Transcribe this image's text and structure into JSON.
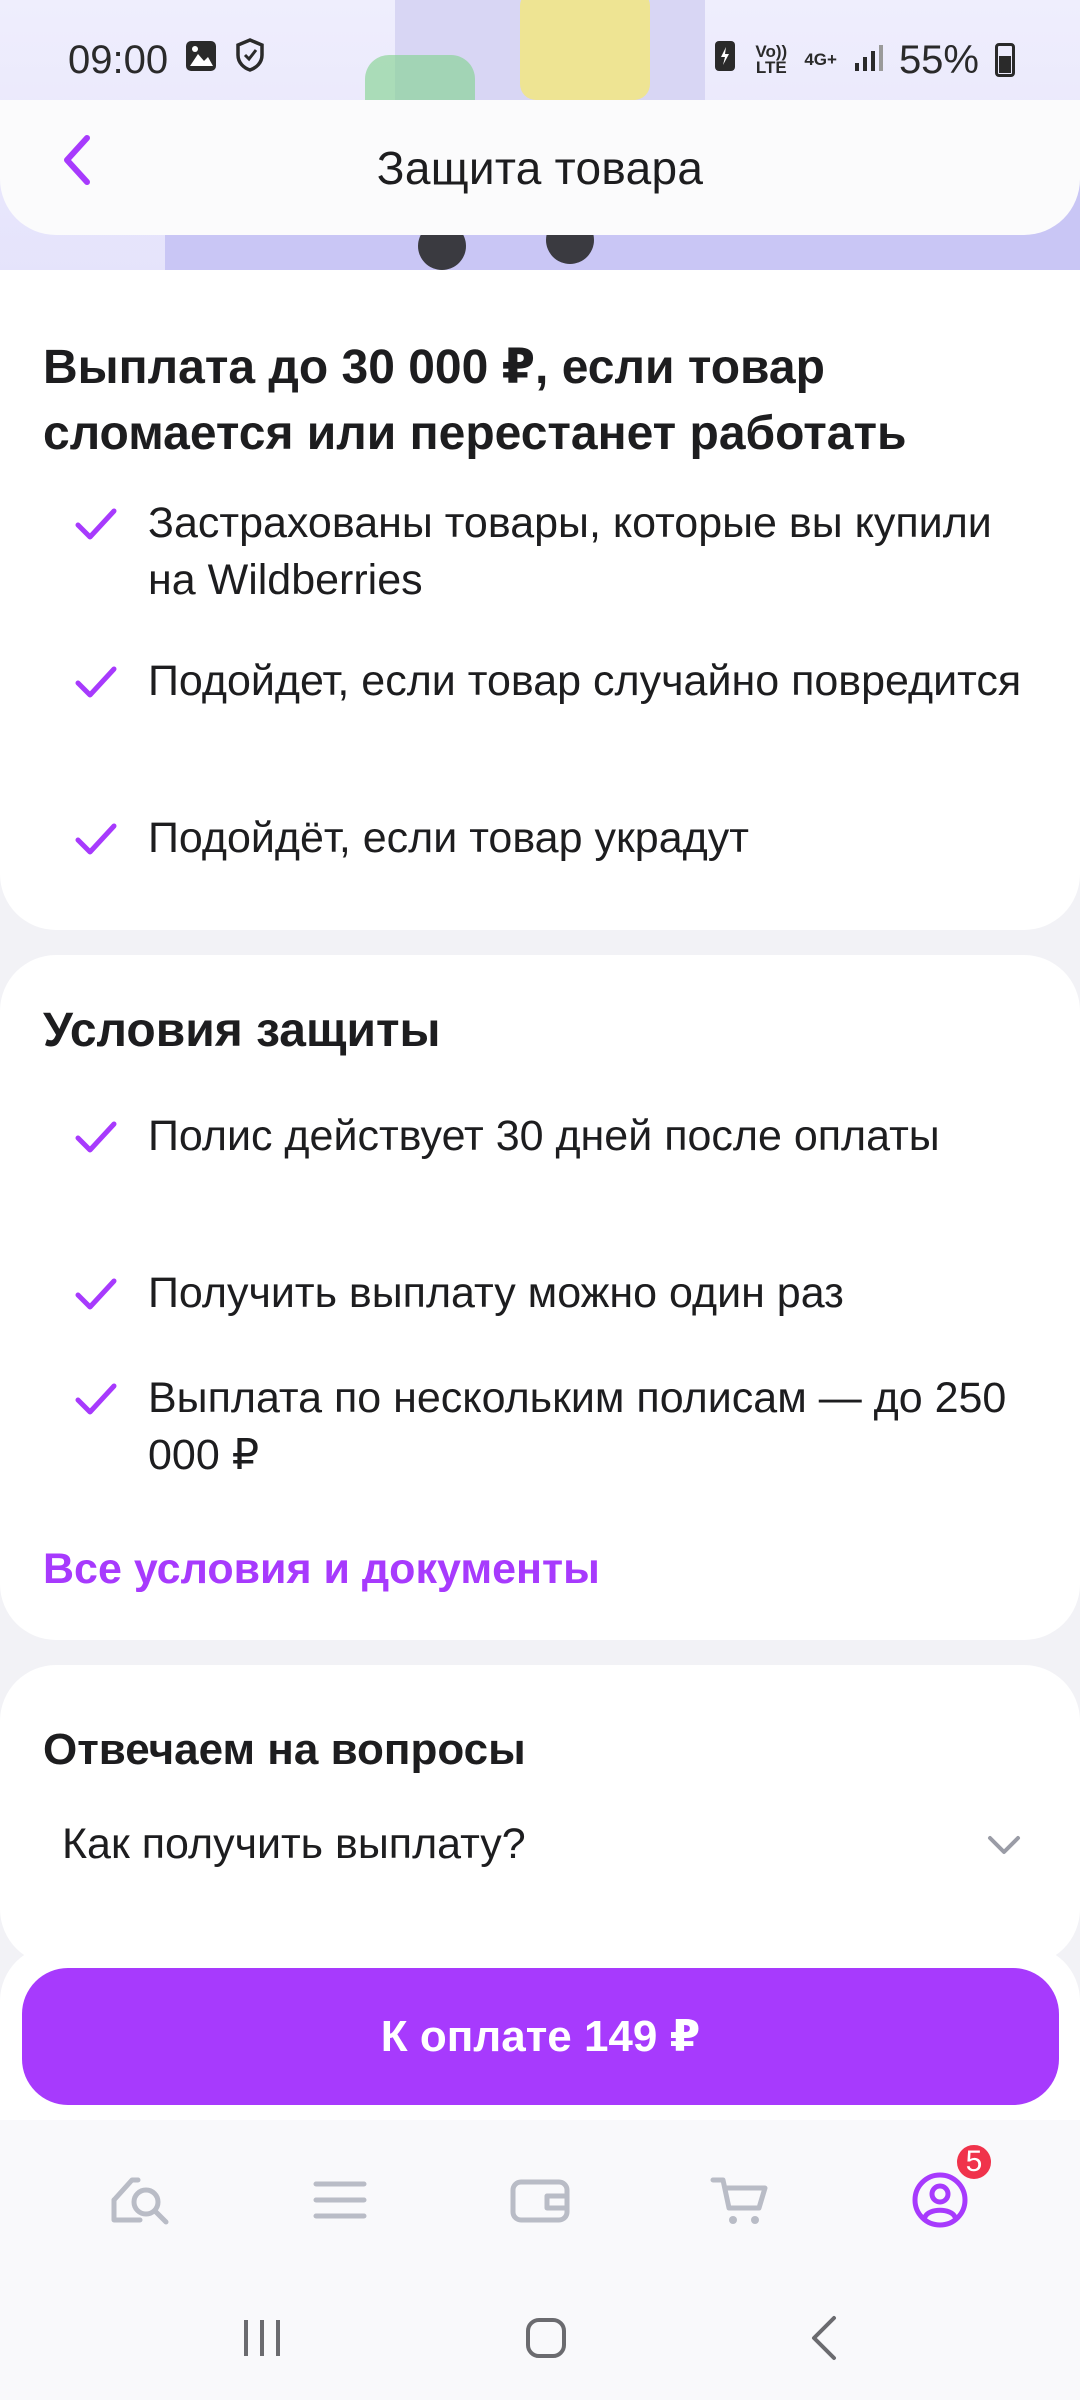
{
  "status_bar": {
    "time": "09:00",
    "net_volte": "Vo)) LTE",
    "net_4g": "4G+",
    "battery": "55%"
  },
  "header": {
    "title": "Защита товара"
  },
  "benefits": {
    "title": "Выплата до 30 000 ₽, если товар сломается или перестанет работать",
    "items": [
      "Застрахованы товары, которые вы купили на Wildberries",
      "Подойдет, если товар случайно повредится",
      "Подойдёт, если товар украдут"
    ]
  },
  "conditions": {
    "title": "Условия защиты",
    "items": [
      "Полис действует 30 дней после оплаты",
      "Получить выплату можно один раз",
      "Выплата по нескольким полисам — до 250 000 ₽"
    ],
    "link": "Все условия и документы"
  },
  "faq": {
    "title": "Отвечаем на вопросы",
    "question": "Как получить выплату?"
  },
  "pay_button": {
    "label": "К оплате 149 ₽"
  },
  "bottom_nav": {
    "profile_badge": "5"
  },
  "colors": {
    "accent": "#a73afd",
    "badge": "#f0334b",
    "nav_icon": "#b9bcc6"
  }
}
